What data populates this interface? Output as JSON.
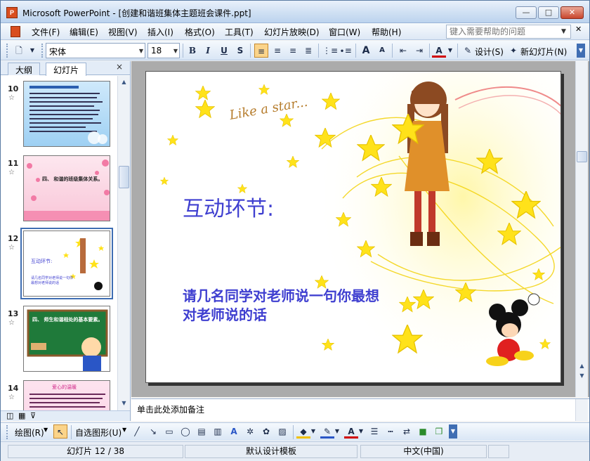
{
  "window": {
    "title": "Microsoft PowerPoint - [创建和谐班集体主题班会课件.ppt]",
    "app_icon_label": "P",
    "controls": {
      "minimize": "—",
      "maximize": "□",
      "close": "✕"
    }
  },
  "menubar": {
    "items": [
      "文件(F)",
      "编辑(E)",
      "视图(V)",
      "插入(I)",
      "格式(O)",
      "工具(T)",
      "幻灯片放映(D)",
      "窗口(W)",
      "帮助(H)"
    ],
    "help_placeholder": "键入需要帮助的问题"
  },
  "toolbar": {
    "font_name": "宋体",
    "font_size": "18",
    "bold": "B",
    "italic": "I",
    "underline": "U",
    "shadow": "S",
    "grow": "A",
    "shrink": "A",
    "font_color": "A",
    "design_label": "设计(S)",
    "new_slide_label": "新幻灯片(N)"
  },
  "left_pane": {
    "tabs": [
      "大纲",
      "幻灯片"
    ],
    "active_tab": "幻灯片",
    "close": "×",
    "thumbnails": [
      {
        "number": "10",
        "theme": "blue-text"
      },
      {
        "number": "11",
        "theme": "pink-hearts"
      },
      {
        "number": "12",
        "theme": "stars-current",
        "selected": true
      },
      {
        "number": "13",
        "theme": "blackboard"
      },
      {
        "number": "14",
        "theme": "pink-text"
      }
    ],
    "thumb_texts": {
      "t11": "四、 和谐的班级集体关系。",
      "t12_title": "互动环节:",
      "t12_body": "请几名同学对老师说一句你最想对老师说的话",
      "t13": "四、 师生和谐相处的基本要素。",
      "t14": "爱心的温暖"
    }
  },
  "slide": {
    "title": "互动环节:",
    "body": "请几名同学对老师说一句你最想对老师说的话",
    "decoration_text": "Like a star..."
  },
  "notes": {
    "placeholder": "单击此处添加备注"
  },
  "drawbar": {
    "draw_label": "绘图(R)",
    "autoshapes_label": "自选图形(U)"
  },
  "statusbar": {
    "slide_info": "幻灯片 12 / 38",
    "template": "默认设计模板",
    "language": "中文(中国)"
  },
  "colors": {
    "slide_text": "#3f3fd0",
    "star_yellow": "#ffe21a",
    "selection": "#3f6eb3"
  }
}
